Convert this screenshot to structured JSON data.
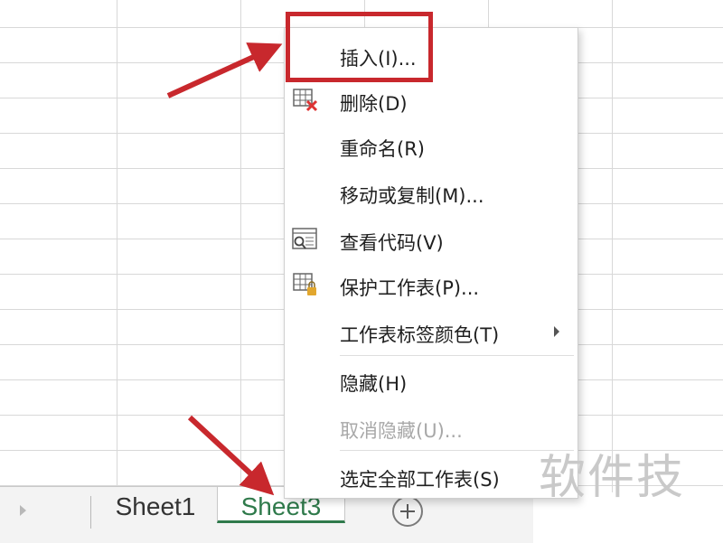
{
  "sheet_tabs": {
    "tabs": [
      {
        "label": "Sheet1",
        "active": false
      },
      {
        "label": "Sheet3",
        "active": true
      }
    ],
    "add_icon": "plus-circle-icon"
  },
  "context_menu": {
    "items": [
      {
        "label": "插入(I)...",
        "icon": null,
        "enabled": true
      },
      {
        "label": "删除(D)",
        "icon": "delete-sheet-icon",
        "enabled": true
      },
      {
        "label": "重命名(R)",
        "icon": null,
        "enabled": true
      },
      {
        "label": "移动或复制(M)...",
        "icon": null,
        "enabled": true
      },
      {
        "label": "查看代码(V)",
        "icon": "view-code-icon",
        "enabled": true
      },
      {
        "label": "保护工作表(P)...",
        "icon": "protect-sheet-icon",
        "enabled": true
      },
      {
        "label": "工作表标签颜色(T)",
        "icon": null,
        "enabled": true,
        "submenu": true
      },
      {
        "label": "隐藏(H)",
        "icon": null,
        "enabled": true
      },
      {
        "label": "取消隐藏(U)...",
        "icon": null,
        "enabled": false
      },
      {
        "label": "选定全部工作表(S)",
        "icon": null,
        "enabled": true
      }
    ]
  },
  "annotations": {
    "highlight_color": "#c8282d",
    "watermark": "软件技"
  },
  "colors": {
    "active_tab": "#2f7a4b",
    "grid_lines": "#d8d8d8",
    "disabled_text": "#a8a8a8"
  }
}
